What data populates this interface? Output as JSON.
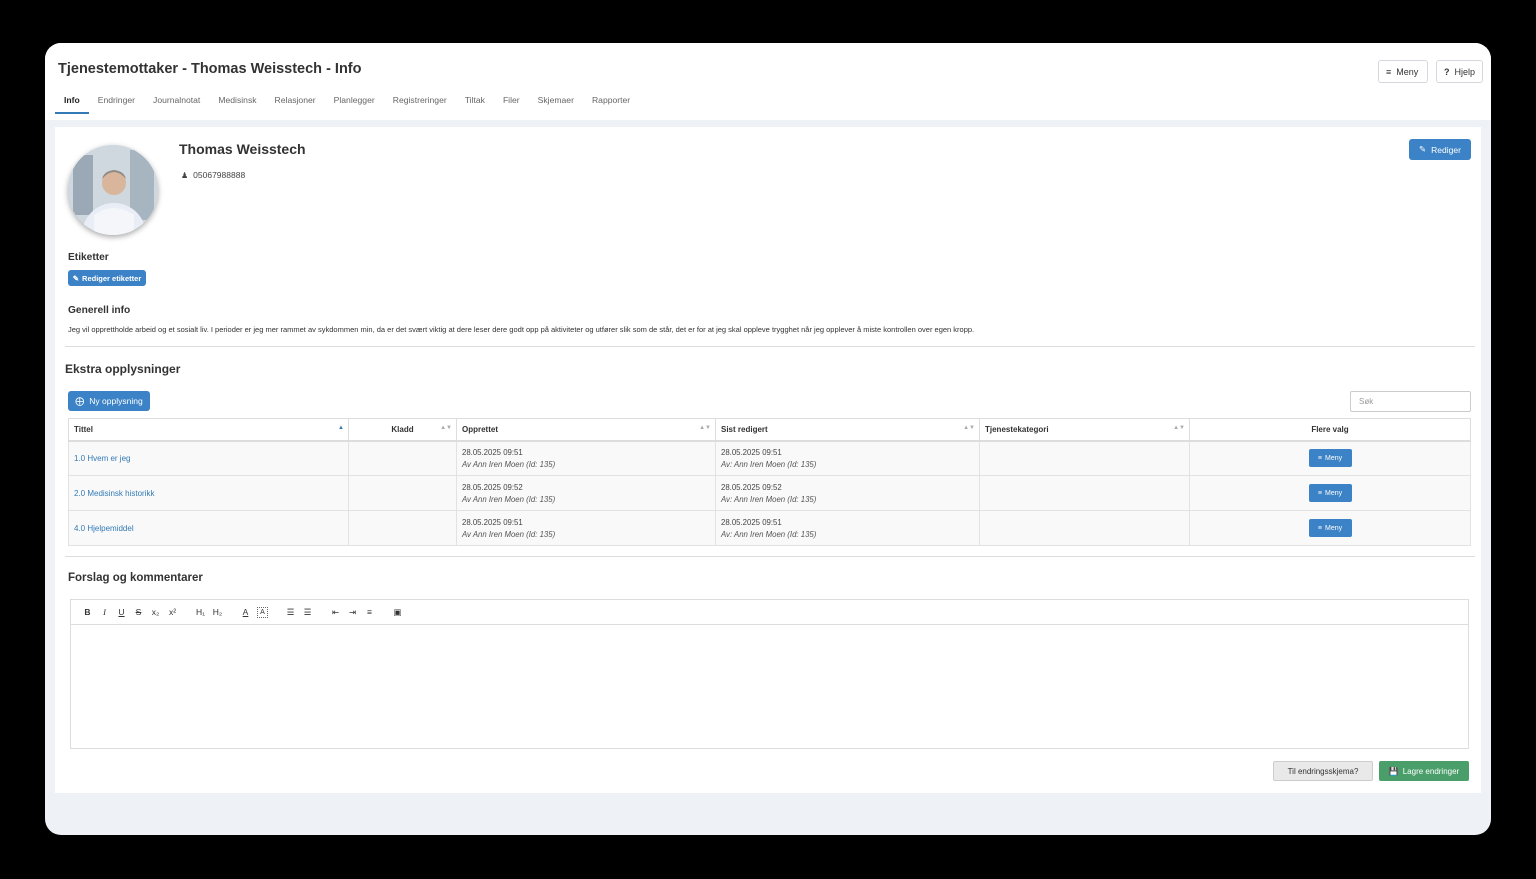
{
  "header": {
    "title": "Tjenestemottaker - Thomas Weisstech - Info",
    "menu_label": "Meny",
    "help_label": "Hjelp"
  },
  "tabs": [
    {
      "label": "Info",
      "active": true
    },
    {
      "label": "Endringer"
    },
    {
      "label": "Journalnotat"
    },
    {
      "label": "Medisinsk"
    },
    {
      "label": "Relasjoner"
    },
    {
      "label": "Planlegger"
    },
    {
      "label": "Registreringer"
    },
    {
      "label": "Tiltak"
    },
    {
      "label": "Filer"
    },
    {
      "label": "Skjemaer"
    },
    {
      "label": "Rapporter"
    }
  ],
  "profile": {
    "name": "Thomas Weisstech",
    "phone": "05067988888",
    "edit_label": "Rediger"
  },
  "tags": {
    "title": "Etiketter",
    "edit_label": "Rediger etiketter"
  },
  "general": {
    "title": "Generell info",
    "text": "Jeg vil opprettholde arbeid og et sosialt liv. I perioder er jeg mer rammet av sykdommen min, da er det svært viktig at dere leser dere godt opp på aktiviteter og utfører slik som de står, det er for at jeg skal oppleve trygghet når jeg opplever å miste kontrollen over egen kropp."
  },
  "extra": {
    "title": "Ekstra opplysninger",
    "new_label": "Ny opplysning",
    "search_placeholder": "Søk",
    "columns": [
      "Tittel",
      "Kladd",
      "Opprettet",
      "Sist redigert",
      "Tjenestekategori",
      "Flere valg"
    ],
    "rows": [
      {
        "title": "1.0 Hvem er jeg",
        "created": "28.05.2025 09:51",
        "created_by": "Av Ann Iren Moen (Id: 135)",
        "edited": "28.05.2025 09:51",
        "edited_by": "Av: Ann Iren Moen (Id: 135)",
        "menu": "Meny"
      },
      {
        "title": "2.0 Medisinsk historikk",
        "created": "28.05.2025 09:52",
        "created_by": "Av Ann Iren Moen (Id: 135)",
        "edited": "28.05.2025 09:52",
        "edited_by": "Av: Ann Iren Moen (Id: 135)",
        "menu": "Meny"
      },
      {
        "title": "4.0 Hjelpemiddel",
        "created": "28.05.2025 09:51",
        "created_by": "Av Ann Iren Moen (Id: 135)",
        "edited": "28.05.2025 09:51",
        "edited_by": "Av: Ann Iren Moen (Id: 135)",
        "menu": "Meny"
      }
    ]
  },
  "comments": {
    "title": "Forslag og kommentarer",
    "toolbar": [
      "B",
      "I",
      "U",
      "S",
      "x₂",
      "x²",
      "H₁",
      "H₂",
      "A",
      "A",
      "ordered-list-icon",
      "bullet-list-icon",
      "outdent-icon",
      "indent-icon",
      "align-icon",
      "image-icon"
    ],
    "change_schema_label": "Til endringsskjema?",
    "save_label": "Lagre endringer"
  },
  "colors": {
    "accent": "#3b82c6",
    "save": "#4a9e6a"
  }
}
